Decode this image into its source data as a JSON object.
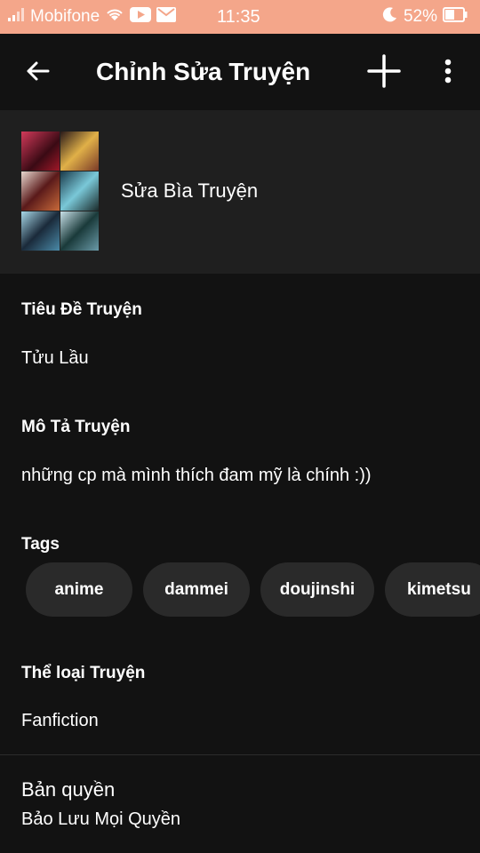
{
  "status_bar": {
    "carrier": "Mobifone",
    "time": "11:35",
    "battery": "52%",
    "icons": [
      "signal-icon",
      "wifi-icon",
      "youtube-icon",
      "gmail-icon",
      "moon-icon",
      "battery-icon"
    ]
  },
  "app_bar": {
    "title": "Chỉnh Sửa Truyện",
    "back_icon": "arrow-left-icon",
    "add_icon": "plus-icon",
    "more_icon": "more-vertical-icon"
  },
  "cover": {
    "label": "Sửa Bìa Truyện",
    "tile_colors": [
      "#8a2a3a",
      "#c9a25c",
      "#6b5a4a",
      "#3f7c8a",
      "#4a8a9a",
      "#8fa7b8"
    ]
  },
  "story": {
    "title_label": "Tiêu Đề Truyện",
    "title_value": "Tửu Lầu",
    "description_label": "Mô Tả Truyện",
    "description_value": "những cp mà mình thích đam mỹ là chính :))",
    "tags_label": "Tags",
    "tags": [
      "anime",
      "dammei",
      "doujinshi",
      "kimetsu"
    ],
    "genre_label": "Thể loại Truyện",
    "genre_value": "Fanfiction",
    "copyright_label": "Bản quyền",
    "copyright_value": "Bảo Lưu Mọi Quyền"
  },
  "colors": {
    "status_bar_bg": "#f4a68a",
    "background": "#121212",
    "cover_section_bg": "#1f1f1f",
    "chip_bg": "#2a2a2a"
  }
}
